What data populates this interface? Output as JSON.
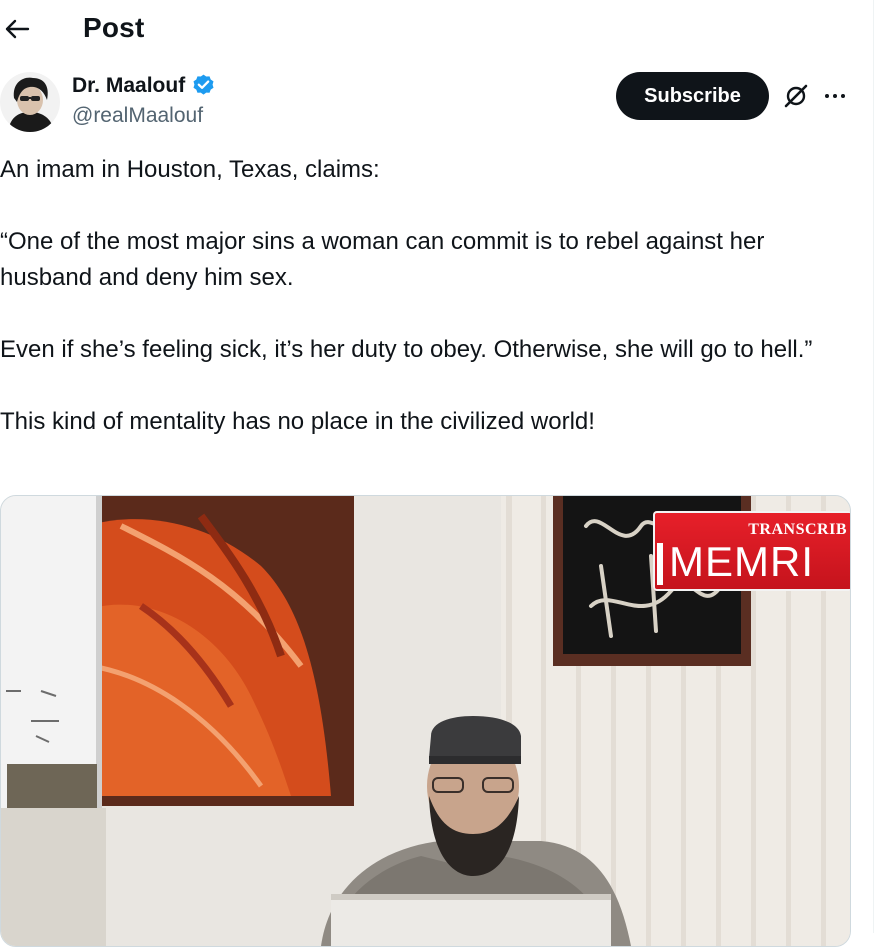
{
  "header": {
    "title": "Post",
    "back_icon": "arrow-left-icon"
  },
  "author": {
    "name": "Dr. Maalouf",
    "handle": "@realMaalouf",
    "verified_icon": "verified-badge-icon",
    "verified_color": "#1d9bf0"
  },
  "actions": {
    "subscribe_label": "Subscribe",
    "grok_icon": "grok-icon",
    "more_icon": "more-horizontal-icon"
  },
  "post": {
    "paragraphs": [
      "An imam in Houston, Texas, claims:",
      "“One of the most major sins a woman can commit is to rebel against her husband and deny him sex.",
      "Even if she’s feeling sick, it’s her duty to obey. Otherwise, she will go to hell.”",
      "This kind of mentality has no place in the civilized world!"
    ]
  },
  "media": {
    "type": "video-thumbnail",
    "badge_top": "TRANSCRIB",
    "badge_main": "MEMRI",
    "badge_color": "#d4161f"
  },
  "colors": {
    "text": "#0f1419",
    "secondary": "#536471",
    "button_bg": "#0f1419",
    "border": "#cfd9de"
  }
}
